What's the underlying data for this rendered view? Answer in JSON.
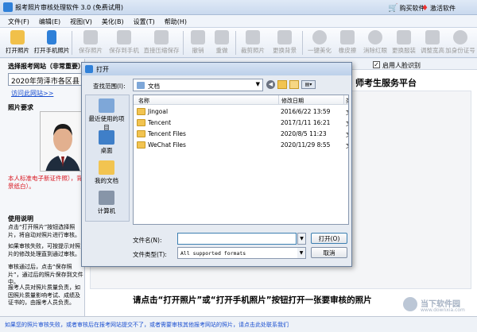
{
  "app": {
    "title": "报考照片审核处理软件 3.0 (免费试用)",
    "buy_label": "购买软件",
    "activate_label": "激活软件"
  },
  "menu": [
    "文件(F)",
    "编辑(E)",
    "视图(V)",
    "美化(B)",
    "设置(T)",
    "帮助(H)"
  ],
  "toolbar": {
    "open_photo": "打开照片",
    "open_phone_photo": "打开手机照片",
    "save_photo": "保存照片",
    "save_to_phone": "保存到手机",
    "direct_save": "直接压缩保存",
    "undo": "撤销",
    "redo": "重做",
    "crop_photo": "裁剪照片",
    "change_bg": "更换背景",
    "one_click_beautify": "一键美化",
    "eraser": "橡皮擦",
    "remove_redeye": "消除红眼",
    "change_clothes": "更换服装",
    "adjust_size": "调整宽高",
    "add_id": "加身份证号"
  },
  "left_panel": {
    "site_heading": "选择报考网站（非常重要）",
    "site_value": "2020年菏泽市各区县",
    "visit_link": "访问此网站>>",
    "photo_req_heading": "照片要求",
    "req_note": "本人标准电子新证件照），背景纸白）。",
    "usage_heading": "使用说明",
    "usage_1": "点击“打开照片”按钮选择照片，将自动对照片进行审核。",
    "usage_2": "如果审核失败，可按提示对照片的修改处理直到通过审核。",
    "usage_3": "审核通过后，点击“保存照片”，通过后的照片保存到文件中。",
    "usage_4": "报考人员对照片质量负责，如因照片质量影响考试、成绩及证书的，由报考人员负责。"
  },
  "main": {
    "recognition_label": "启用人脸识别",
    "platform_title": "师考生服务平台",
    "hint": "请点击“打开照片”或“打开手机照片”按钮打开一张要审核的照片"
  },
  "status": {
    "text": "如果您的照片审核失败，或者审核后在报考网站提交不了，或者需要审核其他报考网站的照片，请点击此处联系我们"
  },
  "dialog": {
    "title": "打开",
    "lookin_label": "查找范围(I):",
    "lookin_value": "文档",
    "col_name": "名称",
    "col_date": "修改日期",
    "col_size": "类",
    "places": [
      "最近使用的项目",
      "桌面",
      "我的文档",
      "计算机"
    ],
    "files": [
      {
        "name": "Jingoal",
        "date": "2016/6/22 13:59",
        "type": "文"
      },
      {
        "name": "Tencent",
        "date": "2017/1/11 16:21",
        "type": "文"
      },
      {
        "name": "Tencent Files",
        "date": "2020/8/5 11:23",
        "type": "文"
      },
      {
        "name": "WeChat Files",
        "date": "2020/11/29 8:55",
        "type": "文"
      }
    ],
    "filename_label": "文件名(N):",
    "filename_value": "",
    "filetype_label": "文件类型(T):",
    "filetype_value": "All supported formats",
    "open_button": "打开(O)",
    "cancel_button": "取消"
  },
  "watermark": {
    "text": "当下软件园",
    "sub": "www.downxia.com"
  },
  "colors": {
    "accent_red": "#d9141e",
    "link_blue": "#1a4fd0",
    "title_bar": "#c9d9ee"
  }
}
